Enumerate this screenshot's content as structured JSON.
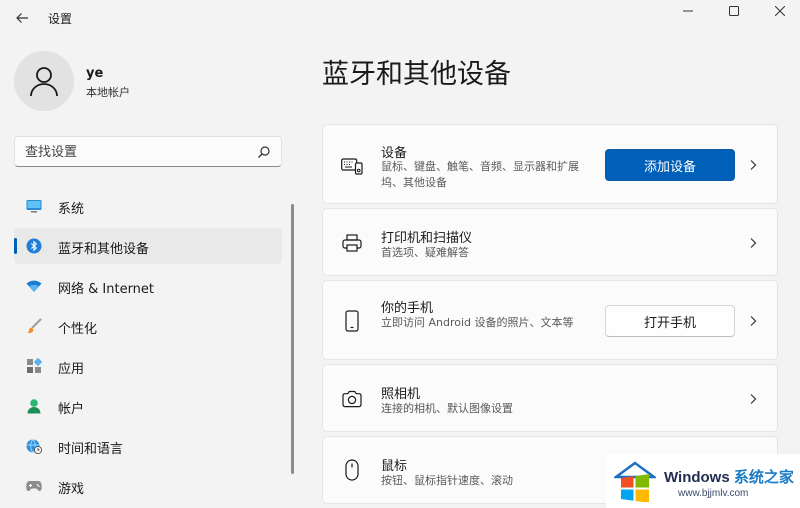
{
  "window": {
    "title": "设置"
  },
  "profile": {
    "name": "ye",
    "account_type": "本地帐户"
  },
  "search": {
    "placeholder": "查找设置"
  },
  "nav": {
    "items": [
      {
        "label": "系统",
        "icon": "monitor-icon"
      },
      {
        "label": "蓝牙和其他设备",
        "icon": "bluetooth-icon",
        "active": true
      },
      {
        "label": "网络 & Internet",
        "icon": "wifi-icon"
      },
      {
        "label": "个性化",
        "icon": "brush-icon"
      },
      {
        "label": "应用",
        "icon": "apps-icon"
      },
      {
        "label": "帐户",
        "icon": "person-icon"
      },
      {
        "label": "时间和语言",
        "icon": "globe-clock-icon"
      },
      {
        "label": "游戏",
        "icon": "gamepad-icon"
      }
    ]
  },
  "main": {
    "title": "蓝牙和其他设备",
    "cards": [
      {
        "title": "设备",
        "desc": "鼠标、键盘、触笔、音频、显示器和扩展坞、其他设备",
        "button": "添加设备",
        "icon": "devices-icon"
      },
      {
        "title": "打印机和扫描仪",
        "desc": "首选项、疑难解答",
        "icon": "printer-icon"
      },
      {
        "title": "你的手机",
        "desc": "立即访问 Android 设备的照片、文本等",
        "button": "打开手机",
        "icon": "phone-icon"
      },
      {
        "title": "照相机",
        "desc": "连接的相机、默认图像设置",
        "icon": "camera-icon"
      },
      {
        "title": "鼠标",
        "desc": "按钮、鼠标指针速度、滚动",
        "icon": "mouse-icon"
      }
    ]
  },
  "watermark": {
    "brand": "Windows",
    "brand_cn": "系统之家",
    "url": "www.bjjmlv.com"
  },
  "colors": {
    "accent": "#005fb8",
    "background": "#f3f3f3",
    "card": "#fbfbfb"
  }
}
